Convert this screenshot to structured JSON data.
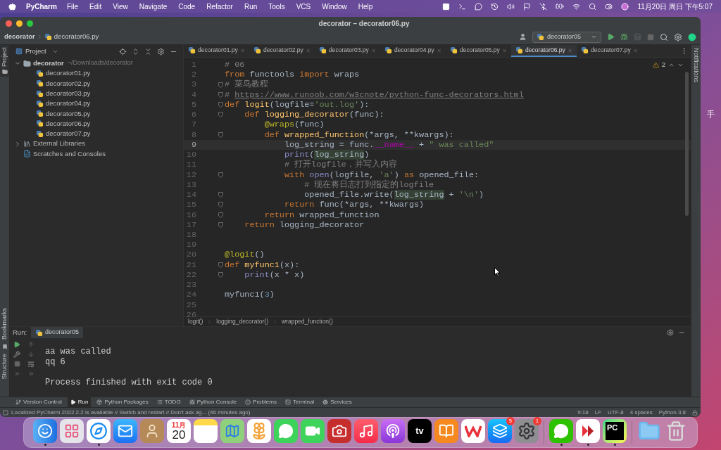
{
  "menubar": {
    "app": "PyCharm",
    "menus": [
      "File",
      "Edit",
      "View",
      "Navigate",
      "Code",
      "Refactor",
      "Run",
      "Tools",
      "VCS",
      "Window",
      "Help"
    ],
    "clock": "11月20日 周日 下午5:07"
  },
  "window": {
    "title": "decorator – decorator06.py",
    "breadcrumb": [
      "decorator",
      "decorator06.py"
    ],
    "run_config": "decorator05"
  },
  "side_tabs": {
    "left_top": "Project",
    "left_bottom": [
      "Bookmarks",
      "Structure"
    ],
    "right": "Notifications"
  },
  "project": {
    "title": "Project",
    "tree": [
      {
        "label": "decorator",
        "path": "~/Downloads/decorator",
        "kind": "folder",
        "expanded": true,
        "children": [
          {
            "label": "decorator01.py",
            "kind": "python"
          },
          {
            "label": "decorator02.py",
            "kind": "python"
          },
          {
            "label": "decorator03.py",
            "kind": "python"
          },
          {
            "label": "decorator04.py",
            "kind": "python"
          },
          {
            "label": "decorator05.py",
            "kind": "python"
          },
          {
            "label": "decorator06.py",
            "kind": "python"
          },
          {
            "label": "decorator07.py",
            "kind": "python"
          }
        ]
      },
      {
        "label": "External Libraries",
        "kind": "libraries",
        "expanded": false
      },
      {
        "label": "Scratches and Consoles",
        "kind": "scratches"
      }
    ]
  },
  "editor": {
    "tabs": [
      {
        "label": "decorator01.py",
        "selected": false
      },
      {
        "label": "decorator02.py",
        "selected": false
      },
      {
        "label": "decorator03.py",
        "selected": false
      },
      {
        "label": "decorator04.py",
        "selected": false
      },
      {
        "label": "decorator05.py",
        "selected": false
      },
      {
        "label": "decorator06.py",
        "selected": true
      },
      {
        "label": "decorator07.py",
        "selected": false
      }
    ],
    "warnings": "2",
    "lines": [
      {
        "n": "1",
        "fold": false,
        "tokens": [
          {
            "kind": "comment",
            "t": "# 06"
          }
        ]
      },
      {
        "n": "2",
        "fold": false,
        "tokens": [
          {
            "kind": "kw",
            "t": "from"
          },
          {
            "kind": "plain",
            "t": " functools "
          },
          {
            "kind": "kw",
            "t": "import"
          },
          {
            "kind": "plain",
            "t": " wraps"
          }
        ]
      },
      {
        "n": "3",
        "fold": true,
        "tokens": [
          {
            "kind": "comment",
            "t": "# 菜鸟教程"
          }
        ]
      },
      {
        "n": "4",
        "fold": true,
        "tokens": [
          {
            "kind": "comment",
            "t": "# "
          },
          {
            "kind": "link",
            "t": "https://www.runoob.com/w3cnote/python-func-decorators.html"
          }
        ]
      },
      {
        "n": "5",
        "fold": true,
        "tokens": [
          {
            "kind": "kw",
            "t": "def "
          },
          {
            "kind": "fn",
            "t": "logit"
          },
          {
            "kind": "plain",
            "t": "(logfile="
          },
          {
            "kind": "str",
            "t": "'out.log'"
          },
          {
            "kind": "plain",
            "t": "):"
          }
        ]
      },
      {
        "n": "6",
        "fold": true,
        "tokens": [
          {
            "kind": "kw",
            "t": "    def "
          },
          {
            "kind": "fn",
            "t": "logging_decorator"
          },
          {
            "kind": "plain",
            "t": "(func):"
          }
        ]
      },
      {
        "n": "7",
        "fold": false,
        "tokens": [
          {
            "kind": "deco",
            "t": "        @wraps"
          },
          {
            "kind": "plain",
            "t": "(func)"
          }
        ]
      },
      {
        "n": "8",
        "fold": true,
        "tokens": [
          {
            "kind": "kw",
            "t": "        def "
          },
          {
            "kind": "fn",
            "t": "wrapped_function"
          },
          {
            "kind": "plain",
            "t": "(*args, **kwargs):"
          }
        ]
      },
      {
        "n": "9",
        "fold": false,
        "current": true,
        "tokens": [
          {
            "kind": "plain",
            "t": "            log_string = func."
          },
          {
            "kind": "magic",
            "t": "__name__"
          },
          {
            "kind": "plain",
            "t": " + "
          },
          {
            "kind": "str",
            "t": "\" was called\""
          }
        ]
      },
      {
        "n": "10",
        "fold": false,
        "tokens": [
          {
            "kind": "builtin",
            "t": "            print"
          },
          {
            "kind": "plain",
            "t": "("
          },
          {
            "kind": "usage",
            "t": "log_string"
          },
          {
            "kind": "plain",
            "t": ")"
          }
        ]
      },
      {
        "n": "11",
        "fold": false,
        "tokens": [
          {
            "kind": "comment",
            "t": "            # 打开logfile，并写入内容"
          }
        ]
      },
      {
        "n": "12",
        "fold": true,
        "tokens": [
          {
            "kind": "kw",
            "t": "            with "
          },
          {
            "kind": "builtin",
            "t": "open"
          },
          {
            "kind": "plain",
            "t": "(logfile, "
          },
          {
            "kind": "str",
            "t": "'a'"
          },
          {
            "kind": "plain",
            "t": ") "
          },
          {
            "kind": "kw",
            "t": "as"
          },
          {
            "kind": "plain",
            "t": " opened_file:"
          }
        ]
      },
      {
        "n": "13",
        "fold": false,
        "tokens": [
          {
            "kind": "comment",
            "t": "                # 现在将日志打到指定的logfile"
          }
        ]
      },
      {
        "n": "14",
        "fold": true,
        "tokens": [
          {
            "kind": "plain",
            "t": "                opened_file.write("
          },
          {
            "kind": "usage",
            "t": "log_string"
          },
          {
            "kind": "plain",
            "t": " + "
          },
          {
            "kind": "str",
            "t": "'\\n'"
          },
          {
            "kind": "plain",
            "t": ")"
          }
        ]
      },
      {
        "n": "15",
        "fold": true,
        "tokens": [
          {
            "kind": "kw",
            "t": "            return"
          },
          {
            "kind": "plain",
            "t": " func(*args, **kwargs)"
          }
        ]
      },
      {
        "n": "16",
        "fold": true,
        "tokens": [
          {
            "kind": "kw",
            "t": "        return"
          },
          {
            "kind": "plain",
            "t": " wrapped_function"
          }
        ]
      },
      {
        "n": "17",
        "fold": true,
        "tokens": [
          {
            "kind": "kw",
            "t": "    return"
          },
          {
            "kind": "plain",
            "t": " logging_decorator"
          }
        ]
      },
      {
        "n": "18",
        "fold": false
      },
      {
        "n": "19",
        "fold": false
      },
      {
        "n": "20",
        "fold": false,
        "tokens": [
          {
            "kind": "deco",
            "t": "@logit"
          },
          {
            "kind": "plain",
            "t": "()"
          }
        ]
      },
      {
        "n": "21",
        "fold": true,
        "tokens": [
          {
            "kind": "kw",
            "t": "def "
          },
          {
            "kind": "fn",
            "t": "myfunc1"
          },
          {
            "kind": "plain",
            "t": "(x):"
          }
        ]
      },
      {
        "n": "22",
        "fold": true,
        "tokens": [
          {
            "kind": "builtin",
            "t": "    print"
          },
          {
            "kind": "plain",
            "t": "(x * x)"
          }
        ]
      },
      {
        "n": "23",
        "fold": false
      },
      {
        "n": "24",
        "fold": false,
        "tokens": [
          {
            "kind": "plain",
            "t": "myfunc1("
          },
          {
            "kind": "num",
            "t": "3"
          },
          {
            "kind": "plain",
            "t": ")"
          }
        ]
      },
      {
        "n": "25",
        "fold": false
      },
      {
        "n": "26",
        "fold": false
      }
    ],
    "breadcrumb": [
      "logit()",
      "logging_decorator()",
      "wrapped_function()"
    ]
  },
  "run": {
    "label": "Run:",
    "tab": "decorator05",
    "output": [
      {
        "text": "aa was called",
        "gap_before": false
      },
      {
        "text": "qq 6",
        "gap_before": false
      },
      {
        "text": "Process finished with exit code 0",
        "gap_before": true
      }
    ]
  },
  "tool_windows": [
    {
      "label": "Version Control",
      "kind": "vcs",
      "selected": false
    },
    {
      "label": "Run",
      "kind": "run",
      "selected": true
    },
    {
      "label": "Python Packages",
      "kind": "packages",
      "selected": false
    },
    {
      "label": "TODO",
      "kind": "todo",
      "selected": false
    },
    {
      "label": "Python Console",
      "kind": "console",
      "selected": false
    },
    {
      "label": "Problems",
      "kind": "problems",
      "selected": false
    },
    {
      "label": "Terminal",
      "kind": "terminal",
      "selected": false
    },
    {
      "label": "Services",
      "kind": "services",
      "selected": false
    }
  ],
  "status": {
    "message": "Localized PyCharm 2022.2.2 is available // Switch and restart // Don't ask ag... (46 minutes ago)",
    "items": [
      "9:18",
      "LF",
      "UTF-8",
      "4 spaces",
      "Python 3.8"
    ]
  },
  "desktop": {
    "fragment": "手"
  },
  "dock": [
    {
      "kind": "finder",
      "running": true
    },
    {
      "kind": "launchpad",
      "running": false
    },
    {
      "kind": "safari",
      "running": true
    },
    {
      "kind": "mail",
      "running": false
    },
    {
      "kind": "contacts",
      "running": false
    },
    {
      "kind": "calendar",
      "month": "11月",
      "day": "20",
      "running": false
    },
    {
      "kind": "notes",
      "running": false
    },
    {
      "kind": "maps",
      "running": false
    },
    {
      "kind": "photos",
      "running": false
    },
    {
      "kind": "messages",
      "running": false
    },
    {
      "kind": "facetime",
      "running": false
    },
    {
      "kind": "photobooth",
      "running": false
    },
    {
      "kind": "music",
      "running": false
    },
    {
      "kind": "podcasts",
      "running": false
    },
    {
      "kind": "tv",
      "label": "tv",
      "running": false
    },
    {
      "kind": "books",
      "running": false
    },
    {
      "kind": "wps",
      "running": false
    },
    {
      "kind": "appstore",
      "badge": "5",
      "running": false
    },
    {
      "kind": "settings",
      "badge": "1",
      "running": false
    },
    {
      "kind": "separator"
    },
    {
      "kind": "wechat",
      "running": true
    },
    {
      "kind": "parallels",
      "running": true
    },
    {
      "kind": "pycharm",
      "label": "PC",
      "running": true
    },
    {
      "kind": "separator"
    },
    {
      "kind": "folder",
      "running": false
    },
    {
      "kind": "trash",
      "running": false
    }
  ]
}
